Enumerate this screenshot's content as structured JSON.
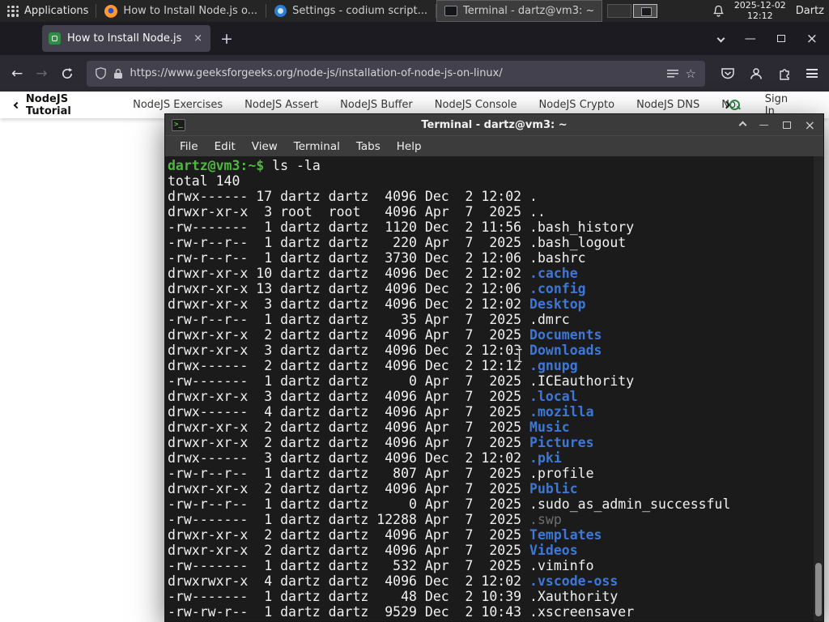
{
  "colors": {
    "gfg_green": "#2f8d46",
    "prompt_green": "#4fb83e",
    "dir_blue": "#3d77d8",
    "terminal_bg": "#1b1b1b"
  },
  "glyphs": {
    "close": "×",
    "plus": "+",
    "back_arrow": "←",
    "forward_arrow": "→",
    "star": "☆",
    "minus": "—",
    "terminal_icon": ">_"
  },
  "system_bar": {
    "applications": "Applications",
    "windows": [
      {
        "title": "How to Install Node.js o..."
      },
      {
        "title": "Settings - codium script..."
      },
      {
        "title": "Terminal - dartz@vm3: ~"
      }
    ],
    "date": "2025-12-02",
    "time": "12:12",
    "user": "Dartz"
  },
  "browser": {
    "tab_title": "How to Install Node.js on",
    "url": "https://www.geeksforgeeks.org/node-js/installation-of-node-js-on-linux/"
  },
  "site_nav": {
    "back_label": "NodeJS Tutorial",
    "items": [
      "NodeJS Exercises",
      "NodeJS Assert",
      "NodeJS Buffer",
      "NodeJS Console",
      "NodeJS Crypto",
      "NodeJS DNS",
      "Node"
    ],
    "sign_in": "Sign In"
  },
  "terminal": {
    "window_title": "Terminal - dartz@vm3: ~",
    "menus": [
      "File",
      "Edit",
      "View",
      "Terminal",
      "Tabs",
      "Help"
    ],
    "prompt": "dartz@vm3:~$",
    "command": " ls -la",
    "output": [
      {
        "pre": "total 140",
        "name": "",
        "type": "plain"
      },
      {
        "pre": "drwx------ 17 dartz dartz  4096 Dec  2 12:02 ",
        "name": ".",
        "type": "plain"
      },
      {
        "pre": "drwxr-xr-x  3 root  root   4096 Apr  7  2025 ",
        "name": "..",
        "type": "plain"
      },
      {
        "pre": "-rw-------  1 dartz dartz  1120 Dec  2 11:56 ",
        "name": ".bash_history",
        "type": "plain"
      },
      {
        "pre": "-rw-r--r--  1 dartz dartz   220 Apr  7  2025 ",
        "name": ".bash_logout",
        "type": "plain"
      },
      {
        "pre": "-rw-r--r--  1 dartz dartz  3730 Dec  2 12:06 ",
        "name": ".bashrc",
        "type": "plain"
      },
      {
        "pre": "drwxr-xr-x 10 dartz dartz  4096 Dec  2 12:02 ",
        "name": ".cache",
        "type": "dir"
      },
      {
        "pre": "drwxr-xr-x 13 dartz dartz  4096 Dec  2 12:06 ",
        "name": ".config",
        "type": "dir"
      },
      {
        "pre": "drwxr-xr-x  3 dartz dartz  4096 Dec  2 12:02 ",
        "name": "Desktop",
        "type": "dir"
      },
      {
        "pre": "-rw-r--r--  1 dartz dartz    35 Apr  7  2025 ",
        "name": ".dmrc",
        "type": "plain"
      },
      {
        "pre": "drwxr-xr-x  2 dartz dartz  4096 Apr  7  2025 ",
        "name": "Documents",
        "type": "dir"
      },
      {
        "pre": "drwxr-xr-x  3 dartz dartz  4096 Dec  2 12:03 ",
        "name": "Downloads",
        "type": "dir"
      },
      {
        "pre": "drwx------  2 dartz dartz  4096 Dec  2 12:12 ",
        "name": ".gnupg",
        "type": "dir"
      },
      {
        "pre": "-rw-------  1 dartz dartz     0 Apr  7  2025 ",
        "name": ".ICEauthority",
        "type": "plain"
      },
      {
        "pre": "drwxr-xr-x  3 dartz dartz  4096 Apr  7  2025 ",
        "name": ".local",
        "type": "dir"
      },
      {
        "pre": "drwx------  4 dartz dartz  4096 Apr  7  2025 ",
        "name": ".mozilla",
        "type": "dir"
      },
      {
        "pre": "drwxr-xr-x  2 dartz dartz  4096 Apr  7  2025 ",
        "name": "Music",
        "type": "dir"
      },
      {
        "pre": "drwxr-xr-x  2 dartz dartz  4096 Apr  7  2025 ",
        "name": "Pictures",
        "type": "dir"
      },
      {
        "pre": "drwx------  3 dartz dartz  4096 Dec  2 12:02 ",
        "name": ".pki",
        "type": "dir"
      },
      {
        "pre": "-rw-r--r--  1 dartz dartz   807 Apr  7  2025 ",
        "name": ".profile",
        "type": "plain"
      },
      {
        "pre": "drwxr-xr-x  2 dartz dartz  4096 Apr  7  2025 ",
        "name": "Public",
        "type": "dir"
      },
      {
        "pre": "-rw-r--r--  1 dartz dartz     0 Apr  7  2025 ",
        "name": ".sudo_as_admin_successful",
        "type": "plain"
      },
      {
        "pre": "-rw-------  1 dartz dartz 12288 Apr  7  2025 ",
        "name": ".swp",
        "type": "dim"
      },
      {
        "pre": "drwxr-xr-x  2 dartz dartz  4096 Apr  7  2025 ",
        "name": "Templates",
        "type": "dir"
      },
      {
        "pre": "drwxr-xr-x  2 dartz dartz  4096 Apr  7  2025 ",
        "name": "Videos",
        "type": "dir"
      },
      {
        "pre": "-rw-------  1 dartz dartz   532 Apr  7  2025 ",
        "name": ".viminfo",
        "type": "plain"
      },
      {
        "pre": "drwxrwxr-x  4 dartz dartz  4096 Dec  2 12:02 ",
        "name": ".vscode-oss",
        "type": "dir"
      },
      {
        "pre": "-rw-------  1 dartz dartz    48 Dec  2 10:39 ",
        "name": ".Xauthority",
        "type": "plain"
      },
      {
        "pre": "-rw-rw-r--  1 dartz dartz  9529 Dec  2 10:43 ",
        "name": ".xscreensaver",
        "type": "plain"
      }
    ]
  }
}
